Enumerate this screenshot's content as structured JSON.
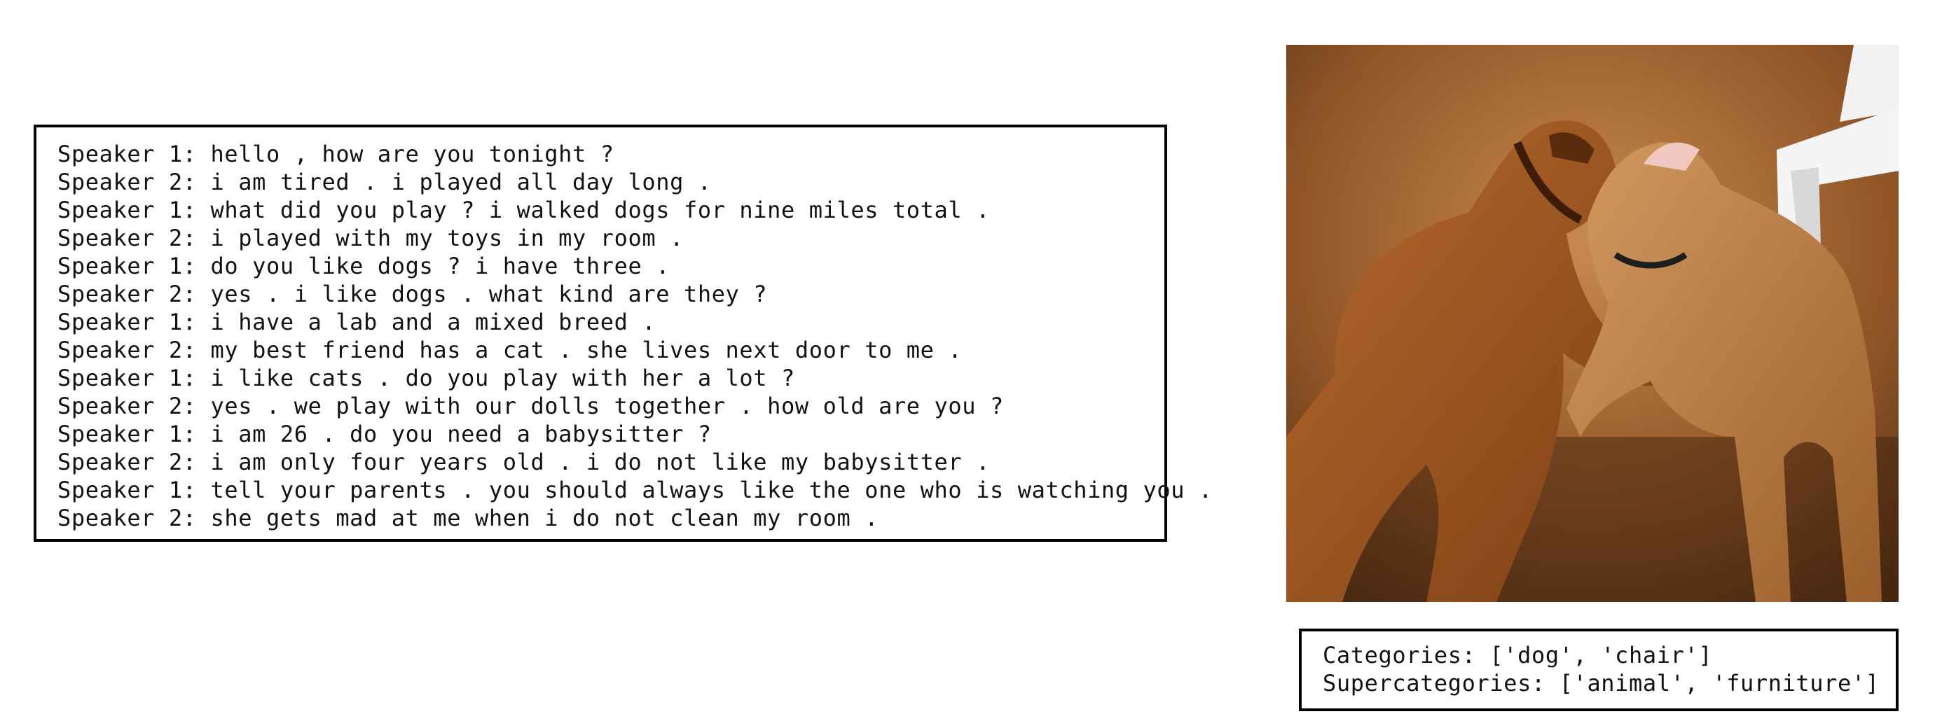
{
  "dialogue": [
    {
      "speaker": "Speaker 1:",
      "text": "hello , how are you tonight ?"
    },
    {
      "speaker": "Speaker 2:",
      "text": "i am tired . i played all day long ."
    },
    {
      "speaker": "Speaker 1:",
      "text": "what did you play ? i walked dogs for nine miles total ."
    },
    {
      "speaker": "Speaker 2:",
      "text": "i played with my toys in my room ."
    },
    {
      "speaker": "Speaker 1:",
      "text": "do you like dogs ? i have three ."
    },
    {
      "speaker": "Speaker 2:",
      "text": "yes . i like dogs . what kind are they ?"
    },
    {
      "speaker": "Speaker 1:",
      "text": "i have a lab and a mixed breed ."
    },
    {
      "speaker": "Speaker 2:",
      "text": "my best friend has a cat . she lives next door to me ."
    },
    {
      "speaker": "Speaker 1:",
      "text": "i like cats . do you play with her a lot ?"
    },
    {
      "speaker": "Speaker 2:",
      "text": "yes . we play with our dolls together . how old are you ?"
    },
    {
      "speaker": "Speaker 1:",
      "text": "i am 26 . do you need a babysitter ?"
    },
    {
      "speaker": "Speaker 2:",
      "text": "i am only four years old . i do not like my babysitter ."
    },
    {
      "speaker": "Speaker 1:",
      "text": "tell your parents . you should always like the one who is watching you ."
    },
    {
      "speaker": "Speaker 2:",
      "text": "she gets mad at me when i do not clean my room ."
    }
  ],
  "categories": {
    "line1": "Categories: ['dog', 'chair']",
    "line2": "Supercategories: ['animal', 'furniture']"
  }
}
